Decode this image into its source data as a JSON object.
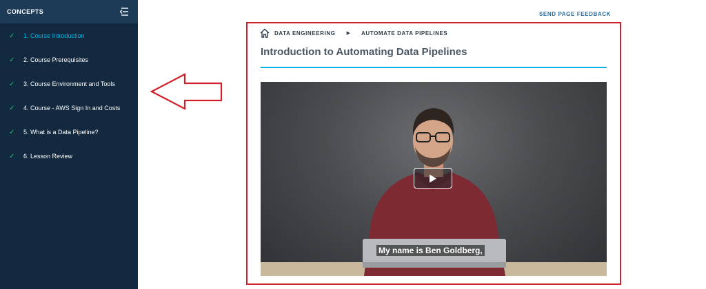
{
  "sidebar": {
    "title": "CONCEPTS",
    "collapse_icon": "collapse-menu-icon",
    "check_icon": "checkmark-icon",
    "check_color": "#1fbf6a",
    "active_color": "#02b3e4",
    "items": [
      {
        "label": "1. Course Introduction",
        "completed": true,
        "active": true
      },
      {
        "label": "2. Course Prerequisites",
        "completed": true,
        "active": false
      },
      {
        "label": "3. Course Environment and Tools",
        "completed": true,
        "active": false
      },
      {
        "label": "4. Course - AWS Sign In and Costs",
        "completed": true,
        "active": false
      },
      {
        "label": "5. What is a Data Pipeline?",
        "completed": true,
        "active": false
      },
      {
        "label": "6. Lesson Review",
        "completed": true,
        "active": false
      }
    ]
  },
  "header": {
    "feedback_label": "SEND PAGE FEEDBACK"
  },
  "breadcrumb": {
    "home_icon": "home-icon",
    "items": [
      "DATA ENGINEERING",
      "AUTOMATE DATA PIPELINES"
    ],
    "separator": "▶"
  },
  "main": {
    "title": "Introduction to Automating Data Pipelines",
    "accent_color": "#02b3e4",
    "annotation_color": "#d0202b"
  },
  "video": {
    "caption": "My name is Ben Goldberg,",
    "play_icon": "play-icon"
  }
}
